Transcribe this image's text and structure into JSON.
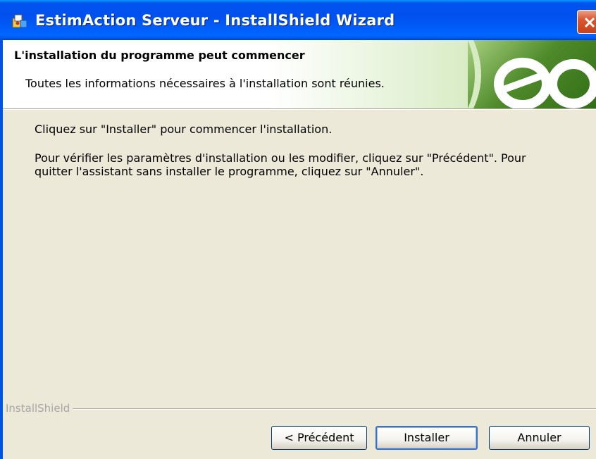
{
  "window": {
    "title": "EstimAction Serveur - InstallShield Wizard"
  },
  "header": {
    "title": "L'installation du programme peut commencer",
    "subtitle": "Toutes les informations nécessaires à l'installation sont réunies."
  },
  "body": {
    "paragraph1": "Cliquez sur \"Installer\" pour commencer l'installation.",
    "paragraph2_line1": "Pour vérifier les paramètres d'installation ou les modifier, cliquez sur \"Précédent\". Pour",
    "paragraph2_line2": "quitter l'assistant sans installer le programme, cliquez sur \"Annuler\"."
  },
  "footer": {
    "brand": "InstallShield",
    "back_button": "< Précédent",
    "install_button": "Installer",
    "cancel_button": "Annuler"
  },
  "icons": {
    "app": "installer-icon",
    "close": "close-icon",
    "logo": "ea-logo"
  },
  "colors": {
    "titlebar": "#0054e3",
    "close": "#d9582f",
    "logo_green": "#4e8a2a",
    "dialog_bg": "#ece9d8"
  }
}
